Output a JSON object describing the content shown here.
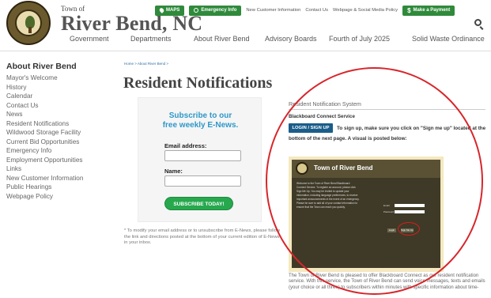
{
  "header": {
    "town_of": "Town of",
    "site_name": "River Bend",
    "site_suffix": ", NC",
    "top_links": {
      "maps": "MAPS",
      "emergency": "Emergency Info",
      "new_customer": "New Customer Information",
      "contact": "Contact Us",
      "webpage_policy": "Webpage & Social Media Policy",
      "payment": "Make a Payment"
    },
    "nav": [
      "Government",
      "Departments",
      "About River Bend",
      "Advisory Boards",
      "Fourth of July 2025",
      "Solid Waste Ordinance"
    ]
  },
  "sidebar": {
    "title": "About River Bend",
    "items": [
      "Mayor's Welcome",
      "History",
      "Calendar",
      "Contact Us",
      "News",
      "Resident Notifications",
      "Wildwood Storage Facility",
      "Current Bid Opportunities",
      "Emergency Info",
      "Employment Opportunities",
      "Links",
      "New Customer Information",
      "Public Hearings",
      "Webpage Policy"
    ]
  },
  "main": {
    "breadcrumb": "Home > About River Bend >",
    "title": "Resident Notifications",
    "enews": {
      "heading_line1": "Subscribe to our",
      "heading_line2": "free weekly E-News.",
      "email_label": "Email address:",
      "name_label": "Name:",
      "button": "SUBSCRIBE TODAY!",
      "note": "* To modify your email address or to unsubscribe from E-News, please follow the link and directions posted at the bottom of your current edition of E-News in your inbox."
    },
    "notification_system": {
      "title": "Resident Notification System",
      "heading": "Blackboard Connect Service",
      "login_button": "LOGIN / SIGN UP",
      "instructions": "To sign up, make sure you click on \"Sign me up\" located at the bottom of the next page.  A visual is posted below:",
      "screenshot": {
        "title": "Town of River Bend",
        "text": "Welcome to the Town of River Bend Blackboard Connect Service. To register an account, please click Sign Me Up. You may be invited to update your information, including language preferences, to receive important announcements in the event of an emergency. Please be sure to add all of your contact information to ensure that the Town can reach you quickly.",
        "email_label": "Email",
        "password_label": "Password",
        "login_btn": "Login",
        "signup_btn": "Sign Me Up"
      },
      "description": "The Town of River Bend is pleased to offer Blackboard Connect as our resident notification service. With this service, the Town of River Bend can send voice messages, texts and emails (your choice or all three) to subscribers within minutes with specific information about time-"
    }
  },
  "colors": {
    "green": "#2f8a3b",
    "title_blue": "#2d98c8",
    "login_blue": "#1a5d8a",
    "annotation_red": "#d7262b"
  }
}
